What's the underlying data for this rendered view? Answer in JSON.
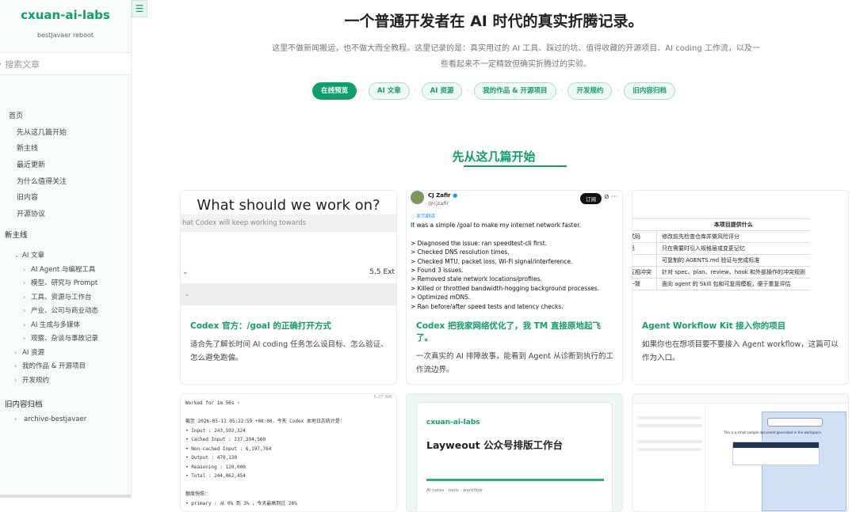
{
  "sidebar": {
    "brand": "cxuan-ai-labs",
    "subtitle": "bestJavaer reboot",
    "search_placeholder": "搜索文章",
    "nav_top": "首页",
    "nav_items": [
      "先从这几篇开始",
      "新主线",
      "最近更新",
      "为什么值得关注",
      "旧内容",
      "开源协议"
    ],
    "group_title": "新主线",
    "tree": [
      {
        "label": "AI 文章",
        "level": 1,
        "open": true
      },
      {
        "label": "AI Agent 与编程工具",
        "level": 2
      },
      {
        "label": "模型、研究与 Prompt",
        "level": 2
      },
      {
        "label": "工具、资源与工作台",
        "level": 2
      },
      {
        "label": "产业、公司与商业动态",
        "level": 2
      },
      {
        "label": "AI 生成与多媒体",
        "level": 2
      },
      {
        "label": "观察、杂谈与事故记录",
        "level": 2
      },
      {
        "label": "AI 资源",
        "level": 1
      },
      {
        "label": "我的作品 & 开源项目",
        "level": 1
      },
      {
        "label": "开发规约",
        "level": 1
      }
    ],
    "archive_title": "旧内容归档",
    "archive_item": "archive-bestjavaer"
  },
  "hero": {
    "title": "一个普通开发者在 AI 时代的真实折腾记录。",
    "desc": "这里不做新闻搬运，也不做大而全教程。这里记录的是：真实用过的 AI 工具、踩过的坑、值得收藏的开源项目、AI coding 工作流，以及一些看起来不一定精致但确实折腾过的实验。"
  },
  "pills": [
    "在线预览",
    "AI 文章",
    "AI 资源",
    "我的作品 & 开源项目",
    "开发规约",
    "旧内容归档"
  ],
  "section_title": "先从这几篇开始",
  "cards": [
    {
      "title": "Codex 官方：/goal 的正确打开方式",
      "desc": "适合先了解长时间 AI coding 任务怎么设目标、怎么验证、怎么避免跑偏。",
      "thumb": {
        "big": "What should we work on?",
        "bar": "hat Codex will keep working towards",
        "left": "⌄",
        "right": "5.5 Ext",
        "bottom": "⌄"
      }
    },
    {
      "title": "Codex 把我家网络优化了，我 TM 直接原地起飞了。",
      "desc": "一次真实的 AI 排障故事，能看到 Agent 从诊断到执行的工作流边界。",
      "thumb": {
        "name": "CJ Zafir",
        "handle": "@cjzafir",
        "subscribe": "订阅",
        "more": "⊘ ···",
        "translate": "◌ 显示翻译",
        "text": "It was a simple /goal to make my internet network faster.\n\n> Diagnosed the issue: ran speedtest-cli first.\n> Checked DNS resolution times,\n> Checked MTU, packet loss, Wi-Fi signal/interference.\n> Found 3 issues.\n> Removed stale network locations/profiles.\n> Killed or throttled bandwidth-hogging background processes.\n> Optimized mDNS.\n> Ran before/after speed tests and latency checks."
      }
    },
    {
      "title": "Agent Workflow Kit 接入你的项目",
      "desc": "如果你也在想项目要不要接入 Agent workflow，这篇可以作为入口。",
      "thumb": {
        "header": "本项目提供什么",
        "rows": [
          [
            "式码",
            "修改前先检查仓库并做风险评分"
          ],
          [
            "忌",
            "只在需要时引入规格层或变更记忆"
          ],
          [
            "",
            "可复制的 AGENTS.md 验证与完成标准"
          ],
          [
            "互相冲突",
            "针对 spec、plan、review、hook 和外部操作的冲突规则"
          ],
          [
            "一致",
            "面向 agent 的 Skill 包和可复用模板，便于重复评估"
          ]
        ]
      }
    }
  ],
  "cards_row2": [
    {
      "thumb_text": "Worked for 1m 56s ›\n\n截至 2026-05-11 05:22:59 +08:00，今天 Codex 本地日志统计是：\n• Input : 243,592,324\n• Cached Input : 237,394,560\n• Non-cached Input : 6,197,764\n• Output : 470,130\n• Reasoning : 120,000\n• Total : 244,062,454\n\n额度快照：\n• primary : 从 0% 到 3% ，今天最高到过 28%",
      "time": "5:27 AM"
    },
    {
      "brand": "cxuan-ai-labs",
      "title": "Layweout 公众号排版工作台",
      "foot": "AI notes · tools · workflow"
    },
    {
      "note": "This is a small sample document generated in the workspace."
    }
  ]
}
